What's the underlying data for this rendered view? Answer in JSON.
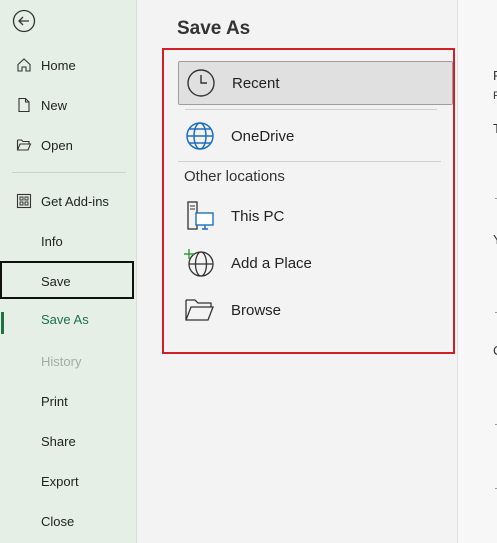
{
  "sidebar": {
    "back_label": "Back",
    "items": [
      {
        "label": "Home",
        "icon": "home-icon"
      },
      {
        "label": "New",
        "icon": "new-file-icon"
      },
      {
        "label": "Open",
        "icon": "folder-open-icon"
      },
      {
        "label": "Get Add-ins",
        "icon": "grid-icon"
      },
      {
        "label": "Info"
      },
      {
        "label": "Save"
      },
      {
        "label": "Save As",
        "selected": true
      },
      {
        "label": "History",
        "disabled": true
      },
      {
        "label": "Print"
      },
      {
        "label": "Share"
      },
      {
        "label": "Export"
      },
      {
        "label": "Close"
      }
    ]
  },
  "main": {
    "title": "Save As",
    "locations": [
      {
        "label": "Recent",
        "icon": "clock-icon",
        "selected": true
      },
      {
        "label": "OneDrive",
        "icon": "globe-icon"
      }
    ],
    "other_heading": "Other locations",
    "other_locations": [
      {
        "label": "This PC",
        "icon": "pc-icon"
      },
      {
        "label": "Add a Place",
        "icon": "add-place-icon"
      },
      {
        "label": "Browse",
        "icon": "folder-icon"
      }
    ]
  },
  "right_panel": {
    "fragments": [
      "P",
      "P",
      "T",
      "Y",
      "C"
    ]
  },
  "colors": {
    "accent": "#1e7145",
    "highlight": "#d11f2a",
    "sidebar_bg": "#e6efe6"
  }
}
